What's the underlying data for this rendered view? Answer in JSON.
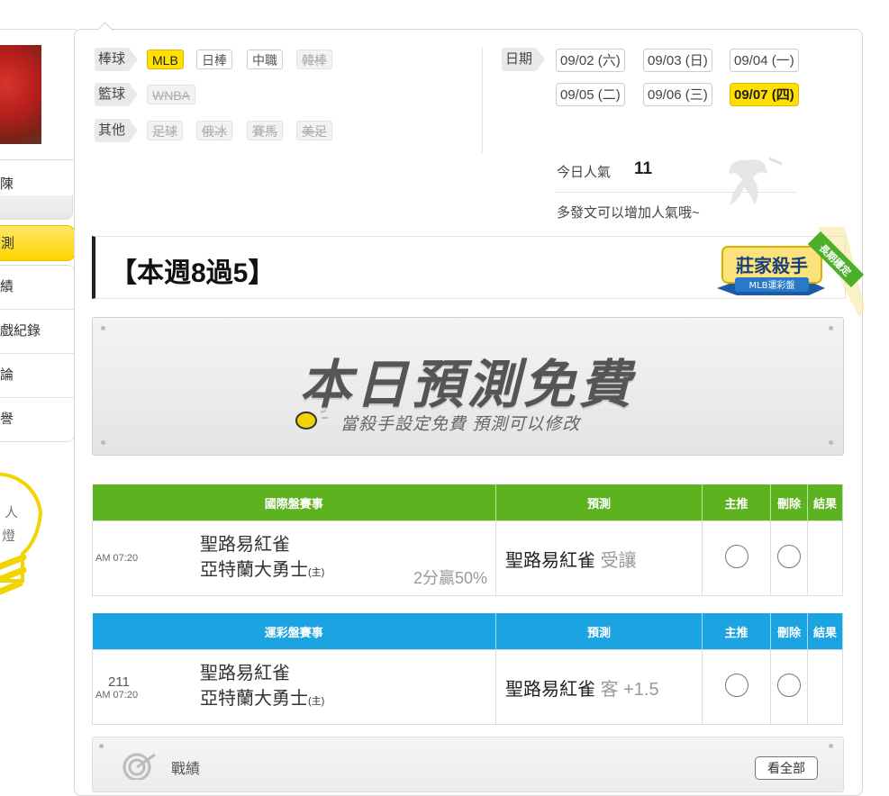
{
  "sidebar": {
    "user_name": "陳",
    "menu_active": "測",
    "menu_items": [
      "績",
      "戲紀錄",
      "論",
      "譽"
    ],
    "bulb_text_1": "人",
    "bulb_text_2": "燈"
  },
  "filters": {
    "baseball_label": "棒球",
    "baseball_chips": [
      "MLB",
      "日棒",
      "中職",
      "韓棒"
    ],
    "basketball_label": "籃球",
    "basketball_chips": [
      "WNBA"
    ],
    "other_label": "其他",
    "other_chips": [
      "足球",
      "俄冰",
      "賽馬",
      "美足"
    ]
  },
  "dates": {
    "label": "日期",
    "items": [
      "09/02 (六)",
      "09/03 (日)",
      "09/04 (一)",
      "09/05 (二)",
      "09/06 (三)",
      "09/07 (四)"
    ],
    "selected": "09/07 (四)"
  },
  "popularity": {
    "label": "今日人氣",
    "value": "11",
    "hint": "多發文可以增加人氣哦~"
  },
  "title": "【本週8過5】",
  "badge": {
    "main": "莊家殺手",
    "sub": "MLB運彩盤",
    "ribbon": "長期穩定"
  },
  "free_banner": {
    "title": "本日預測免費",
    "subtitle": "當殺手設定免費 預測可以修改"
  },
  "intl_table": {
    "headers": [
      "國際盤賽事",
      "預測",
      "主推",
      "刪除",
      "結果"
    ],
    "row": {
      "time": "AM 07:20",
      "away_team": "聖路易紅雀",
      "home_team": "亞特蘭大勇士",
      "home_mark": "(主)",
      "spread": "2分贏50%",
      "pick_team": "聖路易紅雀",
      "pick_type": "受讓"
    }
  },
  "lottery_table": {
    "headers": [
      "運彩盤賽事",
      "預測",
      "主推",
      "刪除",
      "結果"
    ],
    "row": {
      "game_no": "211",
      "time": "AM 07:20",
      "away_team": "聖路易紅雀",
      "home_team": "亞特蘭大勇士",
      "home_mark": "(主)",
      "pick_team": "聖路易紅雀",
      "pick_type": "客 +1.5"
    }
  },
  "record": {
    "label": "戰績",
    "view_all": "看全部"
  },
  "colors": {
    "accent_yellow": "#ffe000",
    "intl_header": "#5cb31f",
    "lottery_header": "#1ba3e2"
  }
}
